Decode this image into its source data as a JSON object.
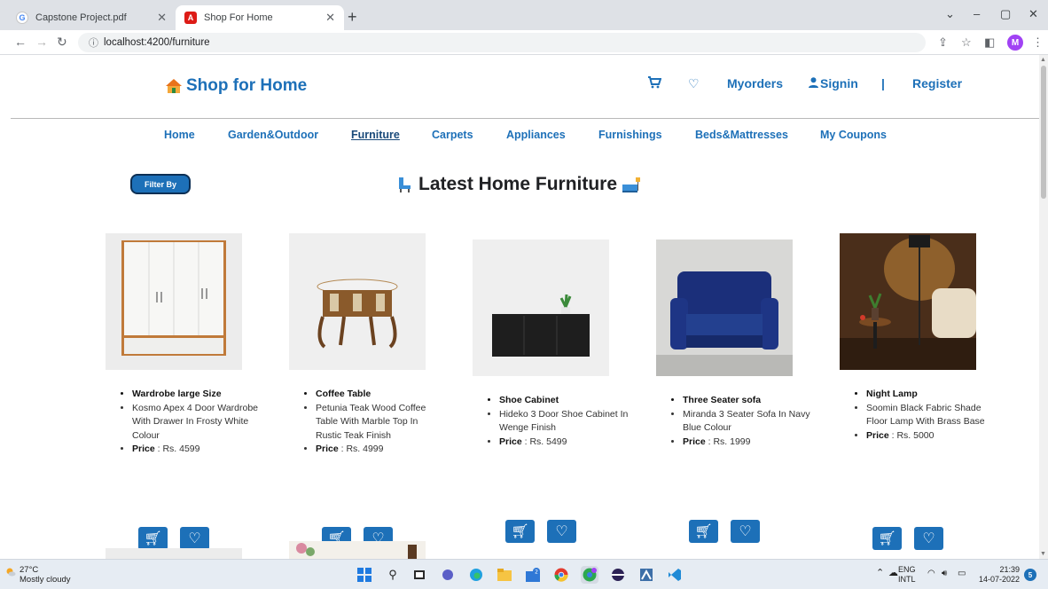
{
  "browser": {
    "tabs": [
      {
        "title": "Capstone Project.pdf",
        "favicon": "G"
      },
      {
        "title": "Shop For Home",
        "favicon": "A"
      }
    ],
    "url": "localhost:4200/furniture",
    "avatar": "M"
  },
  "header": {
    "brand": "Shop for Home",
    "links": {
      "myorders": "Myorders",
      "signin": "Signin",
      "separator": "|",
      "register": "Register"
    }
  },
  "categories": [
    "Home",
    "Garden&Outdoor",
    "Furniture",
    "Carpets",
    "Appliances",
    "Furnishings",
    "Beds&Mattresses",
    "My Coupons"
  ],
  "active_category": "Furniture",
  "filter_label": "Filter By",
  "page_title": "Latest Home Furniture",
  "price_label": "Price",
  "products": [
    {
      "name": "Wardrobe large Size",
      "desc": "Kosmo Apex 4 Door Wardrobe With Drawer In Frosty White Colour",
      "price": ": Rs. 4599"
    },
    {
      "name": "Coffee Table",
      "desc": "Petunia Teak Wood Coffee Table With Marble Top In Rustic Teak Finish",
      "price": ": Rs. 4999"
    },
    {
      "name": "Shoe Cabinet",
      "desc": "Hideko 3 Door Shoe Cabinet In Wenge Finish",
      "price": ": Rs. 5499"
    },
    {
      "name": "Three Seater sofa",
      "desc": "Miranda 3 Seater Sofa In Navy Blue Colour",
      "price": ": Rs. 1999"
    },
    {
      "name": "Night Lamp",
      "desc": "Soomin Black Fabric Shade Floor Lamp With Brass Base",
      "price": ": Rs. 5000"
    }
  ],
  "taskbar": {
    "temp": "27°C",
    "weather": "Mostly cloudy",
    "lang1": "ENG",
    "lang2": "INTL",
    "time": "21:39",
    "date": "14-07-2022",
    "notifications": "5"
  },
  "colors": {
    "brand": "#1d70b8",
    "tabstrip": "#dee1e6",
    "taskbar": "#e6ecf3"
  }
}
